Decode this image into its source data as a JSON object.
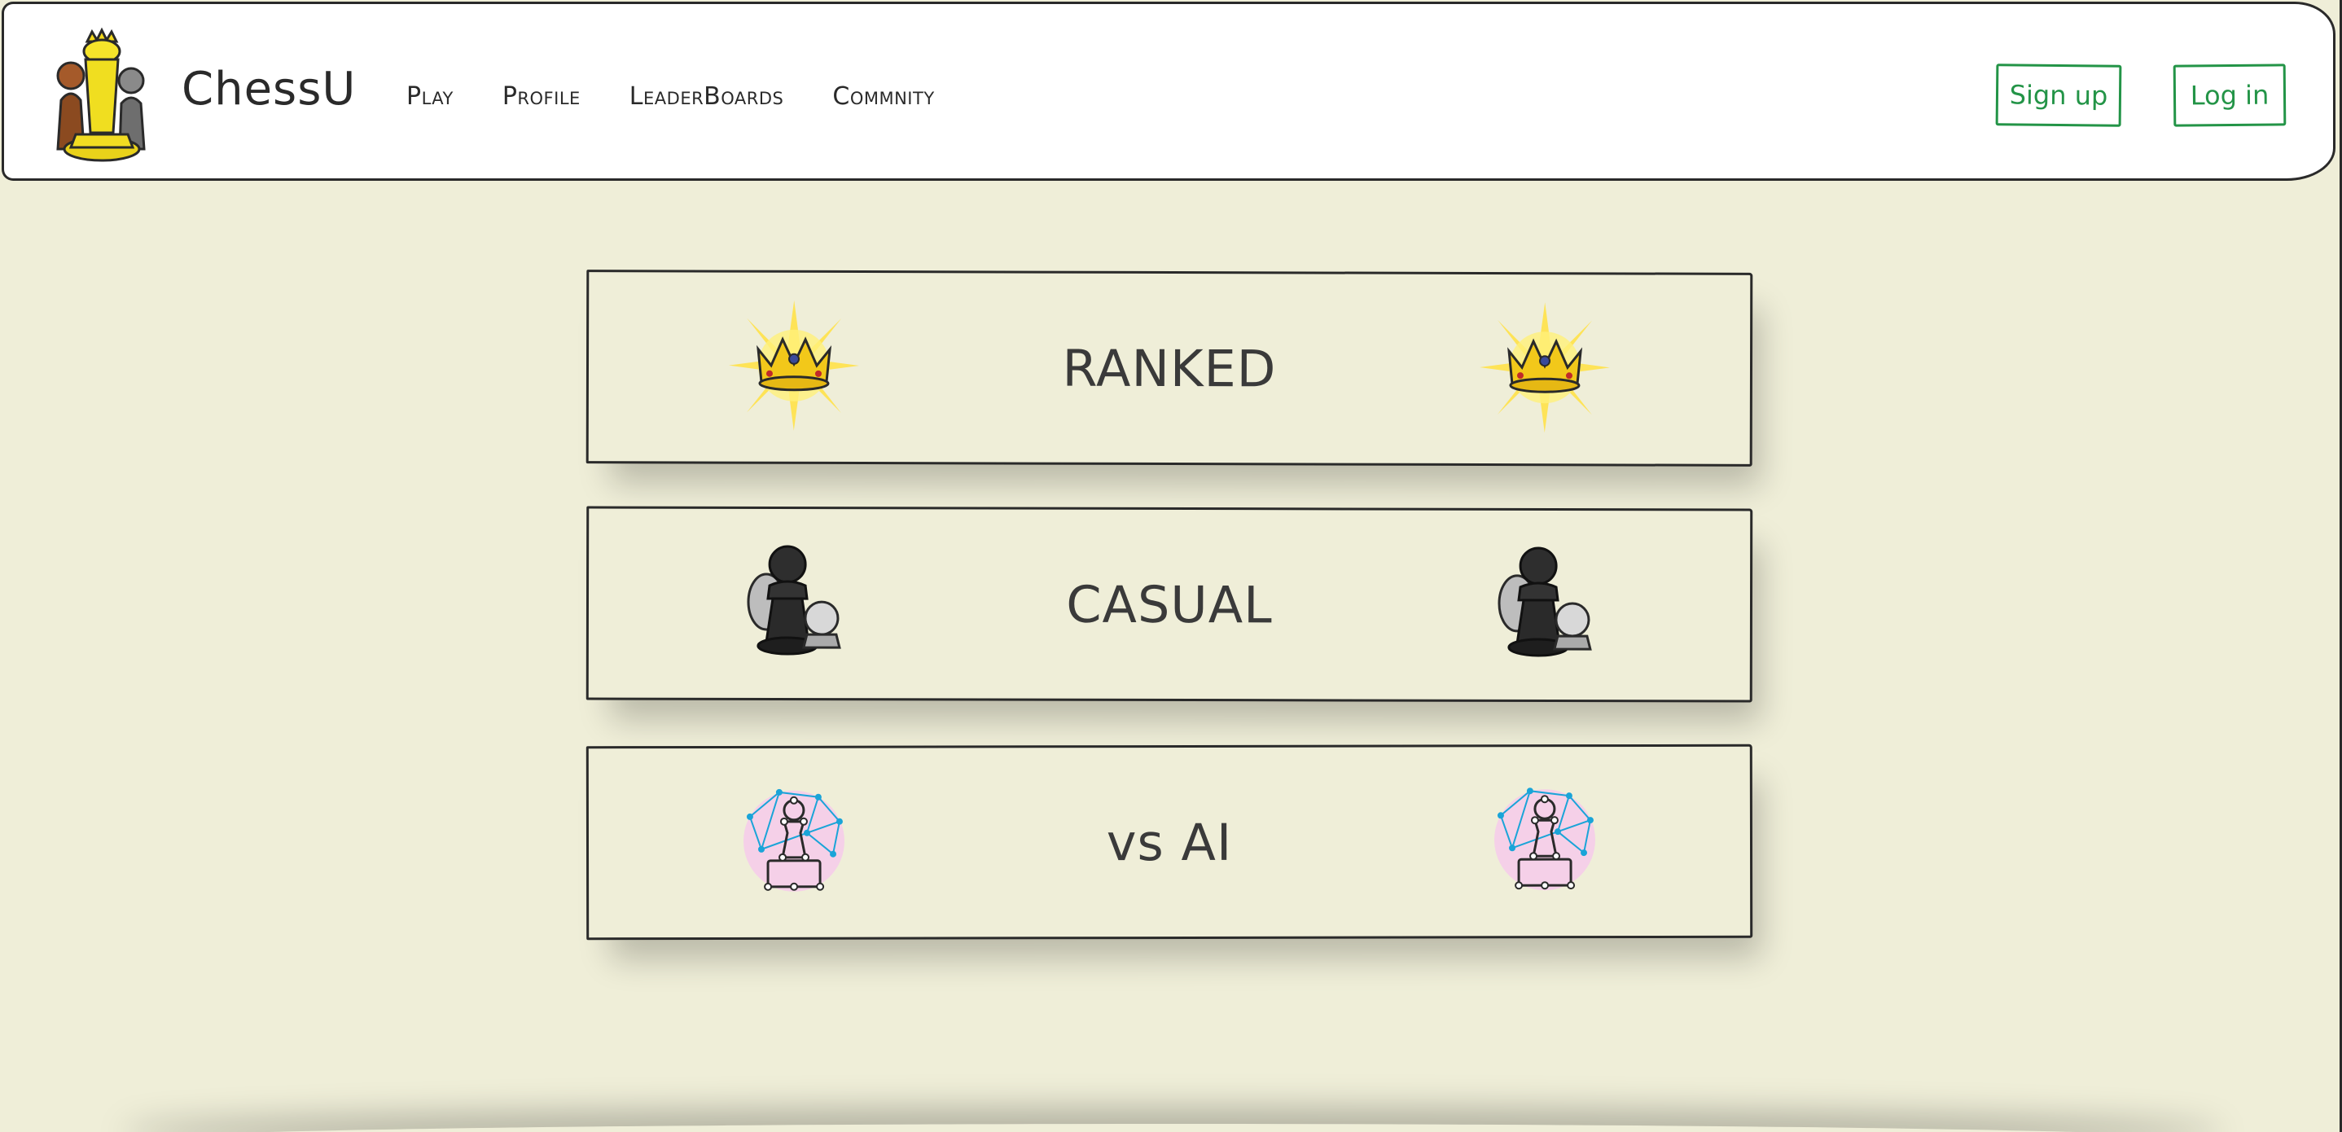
{
  "header": {
    "brand": "ChessU",
    "logo_icon": "chess-pieces-logo-icon",
    "nav": [
      {
        "label": "Play"
      },
      {
        "label": "Profile"
      },
      {
        "label": "LeaderBoards"
      },
      {
        "label": "Commnity"
      }
    ],
    "signup_label": "Sign up",
    "login_label": "Log in"
  },
  "modes": [
    {
      "label": "RANKED",
      "icon": "crown-icon"
    },
    {
      "label": "CASUAL",
      "icon": "pawn-icon"
    },
    {
      "label": "vs AI",
      "icon": "ai-network-pawn-icon"
    }
  ],
  "colors": {
    "background": "#efeed8",
    "header_bg": "#ffffff",
    "accent_green": "#239447",
    "text_dark": "#2a2a2a"
  }
}
